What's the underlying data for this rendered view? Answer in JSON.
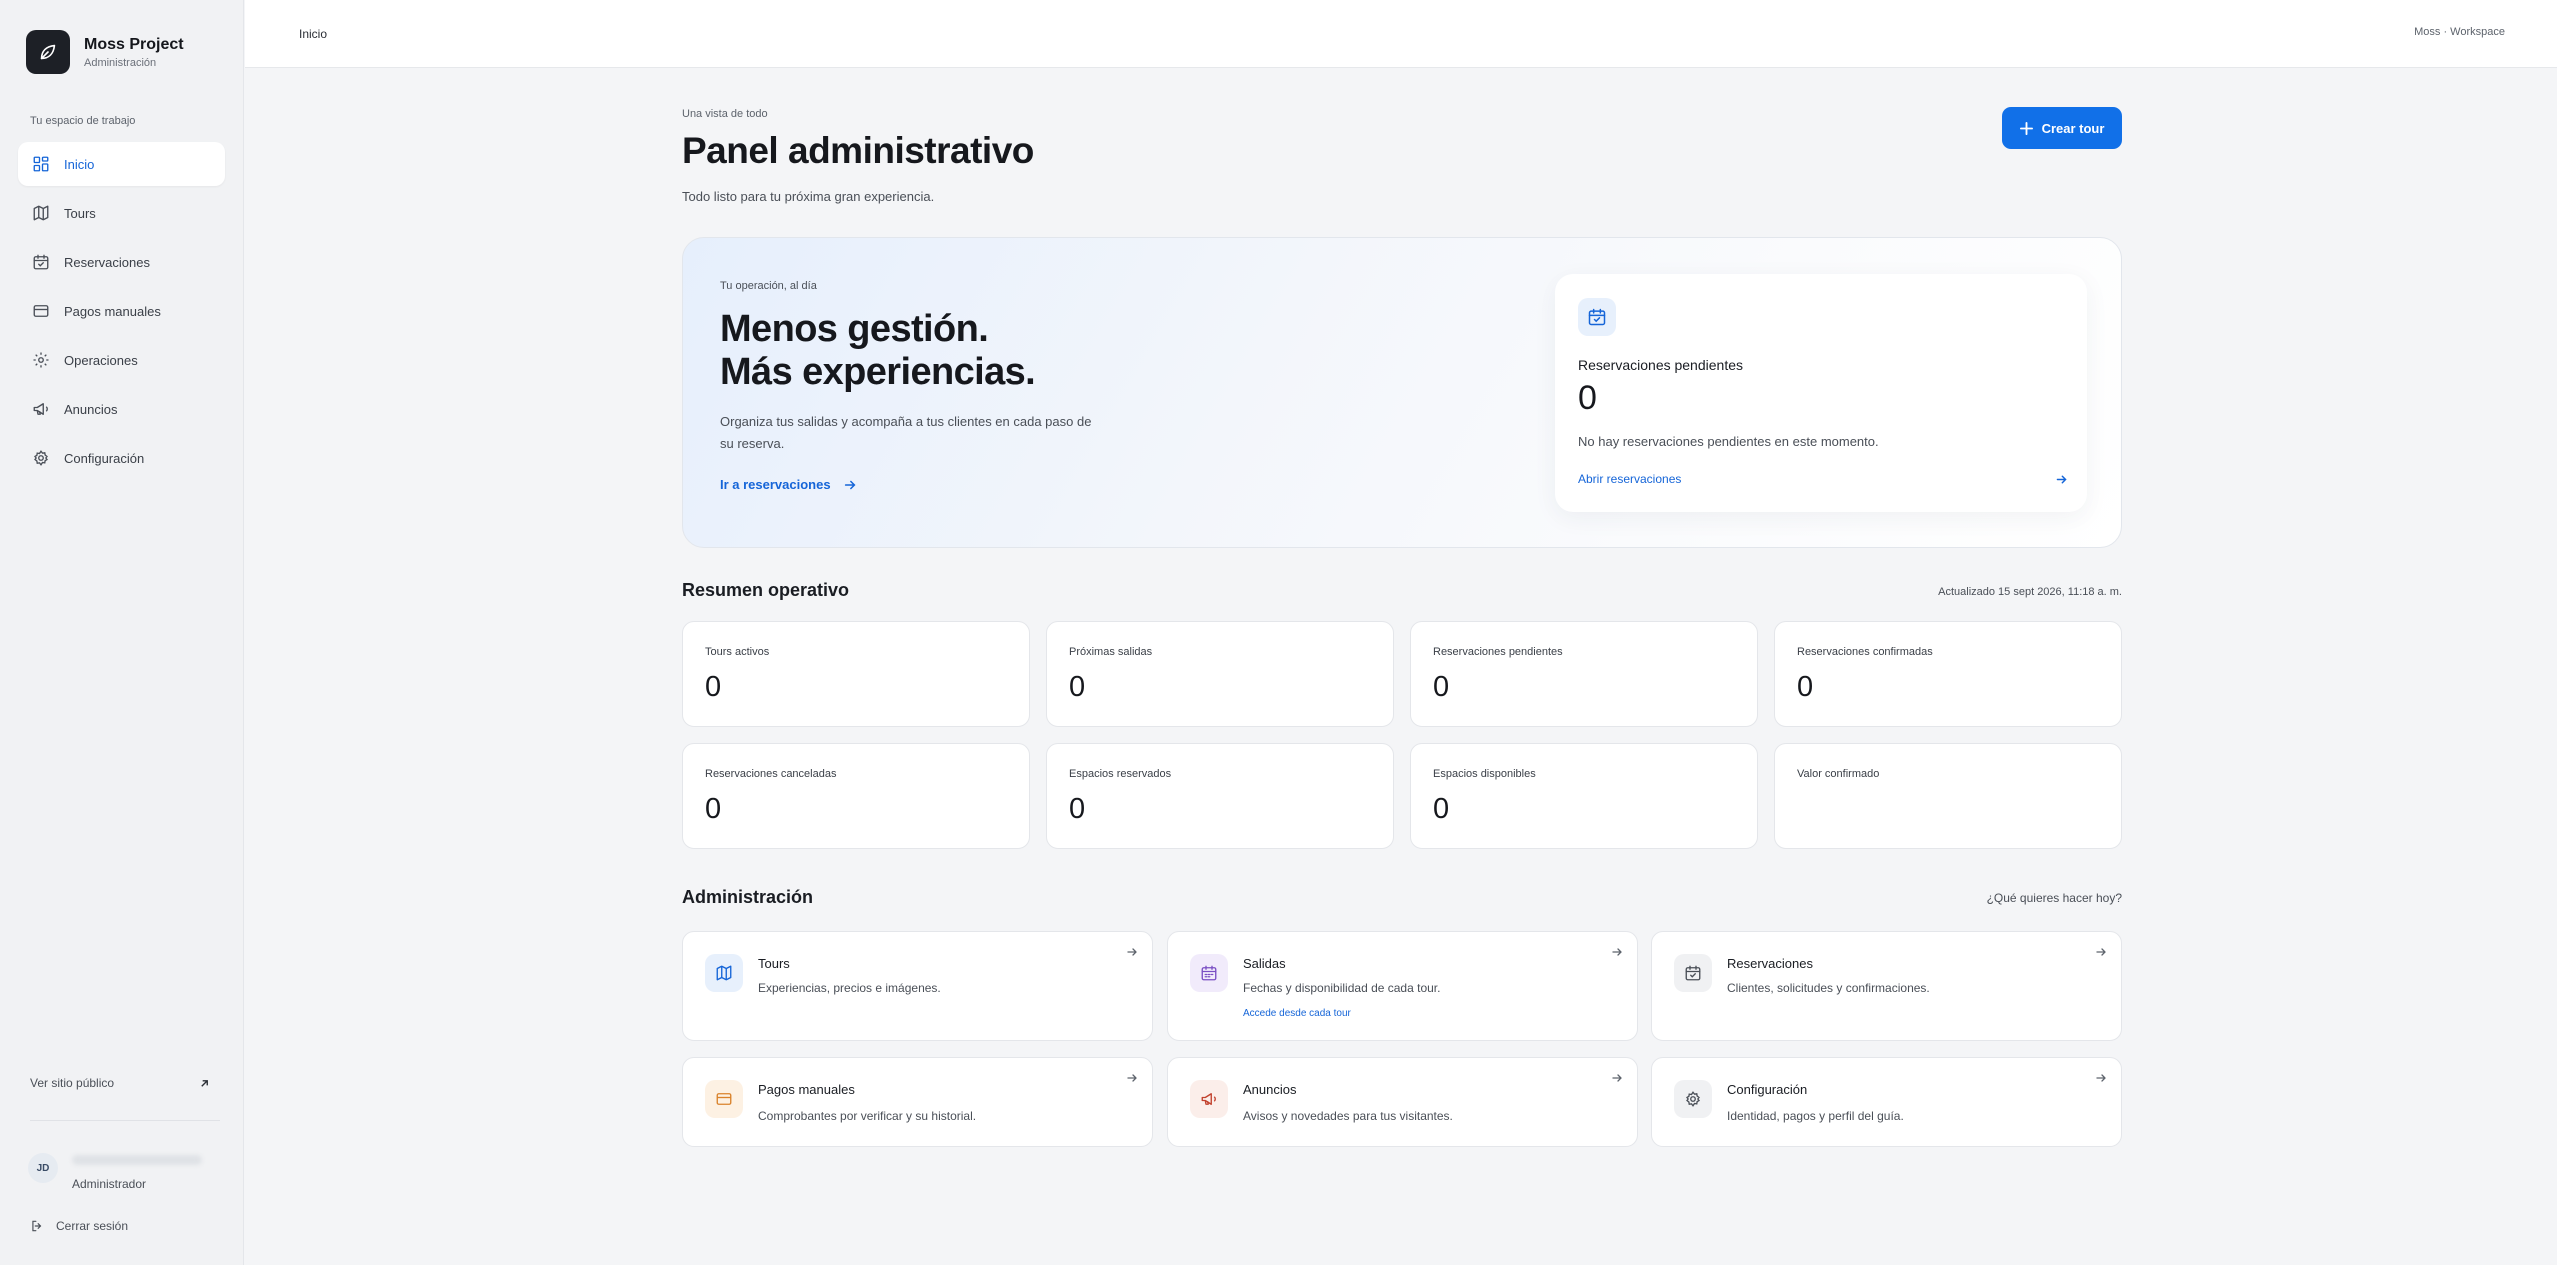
{
  "sidebar": {
    "brand_name": "Moss Project",
    "brand_sub": "Administración",
    "workspace_label": "Tu espacio de trabajo",
    "items": [
      {
        "label": "Inicio",
        "icon": "grid-icon"
      },
      {
        "label": "Tours",
        "icon": "map-icon"
      },
      {
        "label": "Reservaciones",
        "icon": "calendar-check-icon"
      },
      {
        "label": "Pagos manuales",
        "icon": "credit-card-icon"
      },
      {
        "label": "Operaciones",
        "icon": "gear-icon"
      },
      {
        "label": "Anuncios",
        "icon": "megaphone-icon"
      },
      {
        "label": "Configuración",
        "icon": "settings-icon"
      }
    ],
    "public_link": "Ver sitio público",
    "user_initials": "JD",
    "user_role": "Administrador",
    "logout": "Cerrar sesión"
  },
  "topbar": {
    "breadcrumb": "Inicio",
    "workspace": "Moss · Workspace"
  },
  "header": {
    "eyebrow": "Una vista de todo",
    "title": "Panel administrativo",
    "subtitle": "Todo listo para tu próxima gran experiencia.",
    "create_button": "Crear tour"
  },
  "hero": {
    "eyebrow": "Tu operación, al día",
    "title_line1": "Menos gestión.",
    "title_line2": "Más experiencias.",
    "text": "Organiza tus salidas y acompaña a tus clientes en cada paso de su reserva.",
    "link": "Ir a reservaciones",
    "card": {
      "title": "Reservaciones pendientes",
      "value": "0",
      "text": "No hay reservaciones pendientes en este momento.",
      "link": "Abrir reservaciones"
    }
  },
  "summary": {
    "title": "Resumen operativo",
    "updated": "Actualizado 15 sept 2026, 11:18 a. m.",
    "stats": [
      {
        "label": "Tours activos",
        "value": "0"
      },
      {
        "label": "Próximas salidas",
        "value": "0"
      },
      {
        "label": "Reservaciones pendientes",
        "value": "0"
      },
      {
        "label": "Reservaciones confirmadas",
        "value": "0"
      },
      {
        "label": "Reservaciones canceladas",
        "value": "0"
      },
      {
        "label": "Espacios reservados",
        "value": "0"
      },
      {
        "label": "Espacios disponibles",
        "value": "0"
      },
      {
        "label": "Valor confirmado",
        "value": ""
      }
    ]
  },
  "admin": {
    "title": "Administración",
    "prompt": "¿Qué quieres hacer hoy?",
    "cards": [
      {
        "title": "Tours",
        "desc": "Experiencias, precios e imágenes.",
        "sub": "",
        "icon": "map-icon",
        "color": "#1565d8",
        "bg": "#e7f0fc"
      },
      {
        "title": "Salidas",
        "desc": "Fechas y disponibilidad de cada tour.",
        "sub": "Accede desde cada tour",
        "icon": "calendar-icon",
        "color": "#7a4fc4",
        "bg": "#f1ebfb"
      },
      {
        "title": "Reservaciones",
        "desc": "Clientes, solicitudes y confirmaciones.",
        "sub": "",
        "icon": "calendar-check-icon",
        "color": "#4a4f57",
        "bg": "#f0f1f3"
      },
      {
        "title": "Pagos manuales",
        "desc": "Comprobantes por verificar y su historial.",
        "sub": "",
        "icon": "credit-card-icon",
        "color": "#d9822b",
        "bg": "#fdf1e3"
      },
      {
        "title": "Anuncios",
        "desc": "Avisos y novedades para tus visitantes.",
        "sub": "",
        "icon": "megaphone-icon",
        "color": "#c2412d",
        "bg": "#fbeeea"
      },
      {
        "title": "Configuración",
        "desc": "Identidad, pagos y perfil del guía.",
        "sub": "",
        "icon": "settings-icon",
        "color": "#4a4f57",
        "bg": "#f0f1f3"
      }
    ]
  }
}
